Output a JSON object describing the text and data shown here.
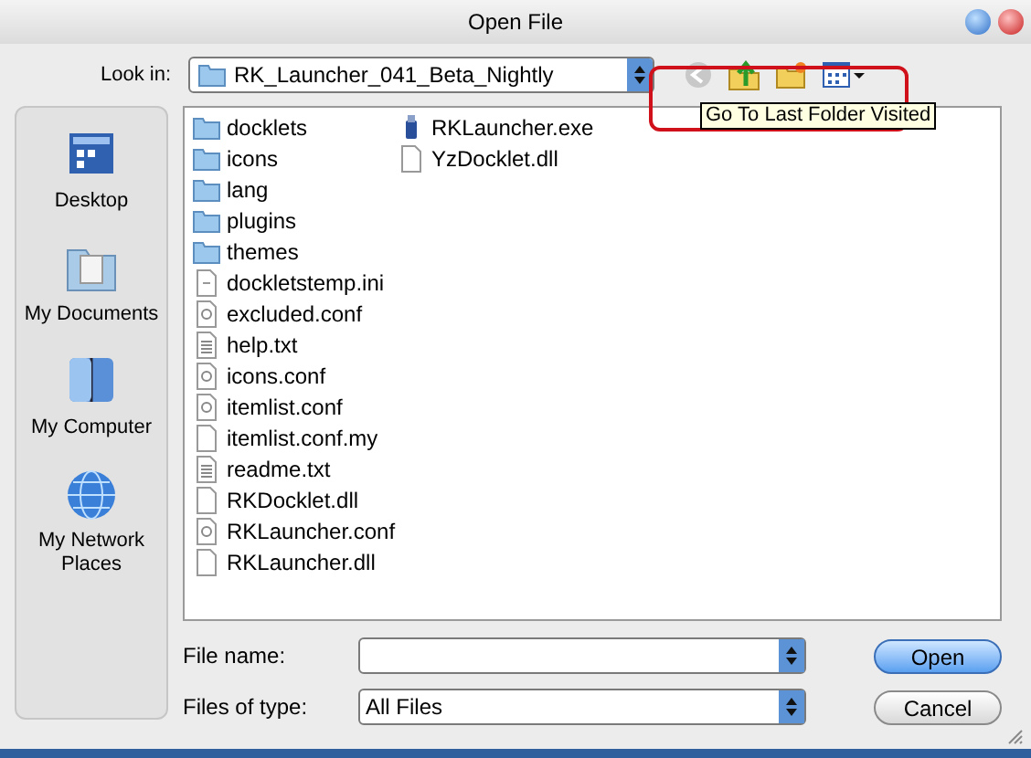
{
  "window": {
    "title": "Open File"
  },
  "look_in": {
    "label": "Look in:",
    "value": "RK_Launcher_041_Beta_Nightly"
  },
  "toolbar": {
    "tooltip": "Go To Last Folder Visited"
  },
  "places": [
    {
      "kind": "desktop",
      "label": "Desktop"
    },
    {
      "kind": "documents",
      "label": "My Documents"
    },
    {
      "kind": "computer",
      "label": "My Computer"
    },
    {
      "kind": "network",
      "label": "My Network Places"
    }
  ],
  "files": [
    {
      "kind": "folder",
      "name": "docklets"
    },
    {
      "kind": "folder",
      "name": "icons"
    },
    {
      "kind": "folder",
      "name": "lang"
    },
    {
      "kind": "folder",
      "name": "plugins"
    },
    {
      "kind": "folder",
      "name": "themes"
    },
    {
      "kind": "ini",
      "name": "dockletstemp.ini"
    },
    {
      "kind": "conf",
      "name": "excluded.conf"
    },
    {
      "kind": "txt",
      "name": "help.txt"
    },
    {
      "kind": "conf",
      "name": "icons.conf"
    },
    {
      "kind": "conf",
      "name": "itemlist.conf"
    },
    {
      "kind": "blank",
      "name": "itemlist.conf.my"
    },
    {
      "kind": "txt",
      "name": "readme.txt"
    },
    {
      "kind": "dll",
      "name": "RKDocklet.dll"
    },
    {
      "kind": "conf",
      "name": "RKLauncher.conf"
    },
    {
      "kind": "dll",
      "name": "RKLauncher.dll"
    },
    {
      "kind": "exe",
      "name": "RKLauncher.exe"
    },
    {
      "kind": "dll",
      "name": "YzDocklet.dll"
    }
  ],
  "file_name": {
    "label": "File name:"
  },
  "file_type": {
    "label": "Files of type:",
    "value": "All Files"
  },
  "buttons": [
    {
      "kind": "primary",
      "label": "Open"
    },
    {
      "kind": "normal",
      "label": "Cancel"
    }
  ]
}
